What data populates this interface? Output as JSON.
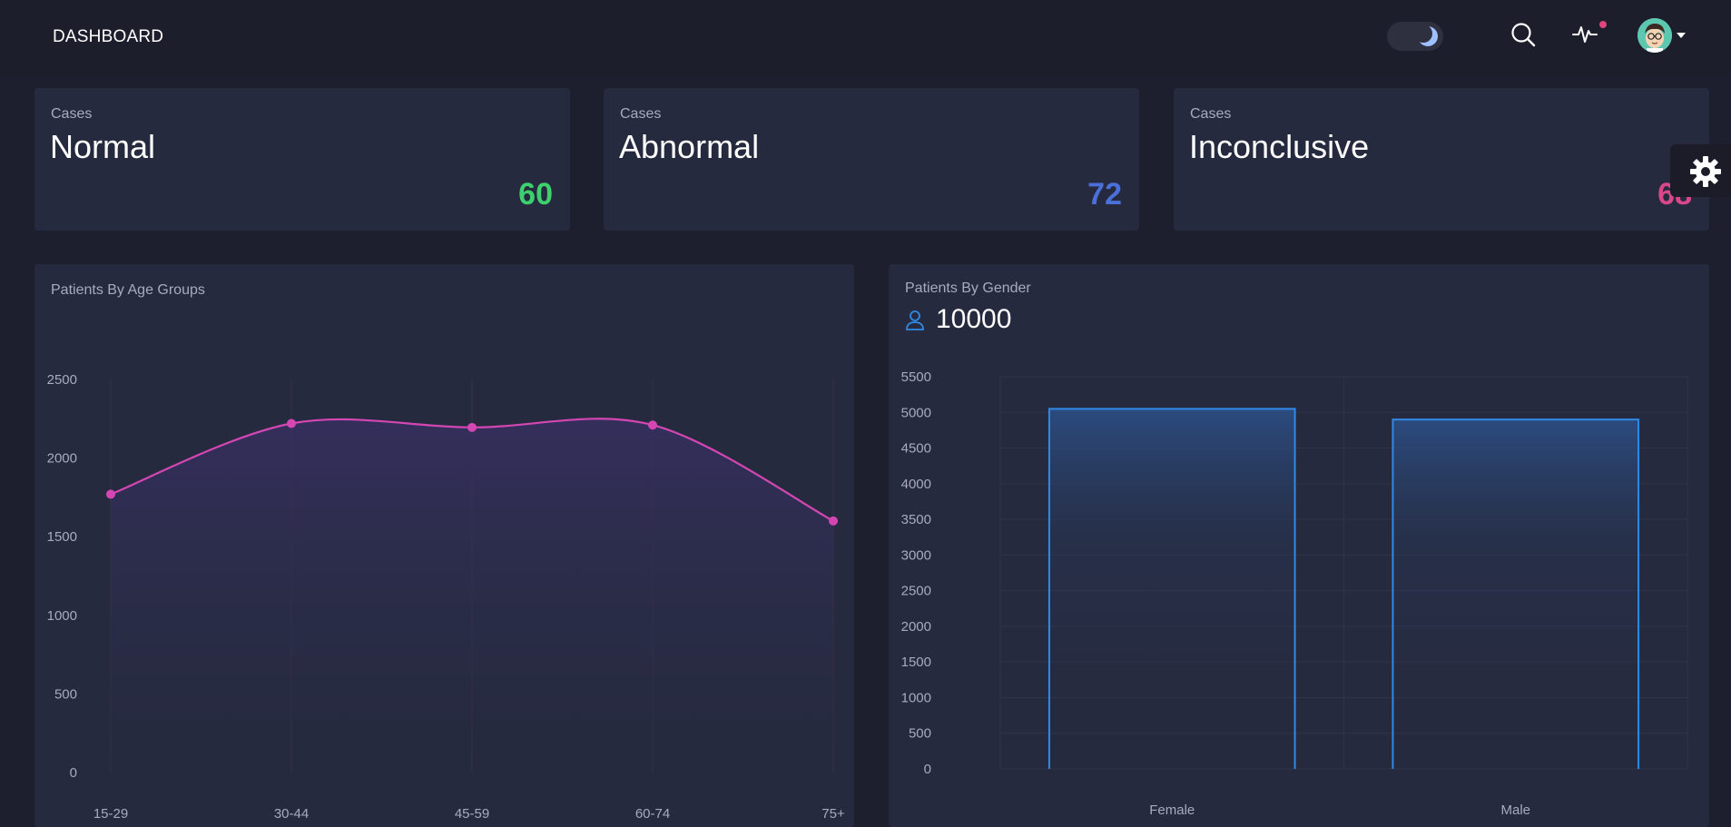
{
  "header": {
    "title": "DASHBOARD",
    "icons": [
      "moon-icon",
      "search-icon",
      "activity-icon",
      "avatar",
      "chevron-down-icon"
    ]
  },
  "cards": [
    {
      "subtitle": "Cases",
      "title": "Normal",
      "value": "60",
      "color": "#3ecf6e"
    },
    {
      "subtitle": "Cases",
      "title": "Abnormal",
      "value": "72",
      "color": "#4a6fd8"
    },
    {
      "subtitle": "Cases",
      "title": "Inconclusive",
      "value": "68",
      "color": "#d9478a"
    }
  ],
  "settings": {
    "icon": "gear-icon"
  },
  "age_chart": {
    "title": "Patients By Age Groups"
  },
  "gender_chart": {
    "title": "Patients By Gender",
    "total": "10000",
    "icon": "user-icon"
  },
  "chart_data": [
    {
      "type": "area",
      "title": "Patients By Age Groups",
      "categories": [
        "15-29",
        "30-44",
        "45-59",
        "60-74",
        "75+"
      ],
      "series": [
        {
          "values": [
            1770,
            2220,
            2195,
            2210,
            1600
          ]
        }
      ],
      "ylim": [
        0,
        2500
      ],
      "yticks": [
        0,
        500,
        1000,
        1500,
        2000,
        2500
      ],
      "color": "#d447b3",
      "grid": true
    },
    {
      "type": "bar",
      "title": "Patients By Gender",
      "categories": [
        "Female",
        "Male"
      ],
      "values": [
        5050,
        4900
      ],
      "ylim": [
        0,
        5500
      ],
      "yticks": [
        0,
        500,
        1000,
        1500,
        2000,
        2500,
        3000,
        3500,
        4000,
        4500,
        5000,
        5500
      ],
      "color": "#2e8ae6",
      "grid": true
    }
  ]
}
